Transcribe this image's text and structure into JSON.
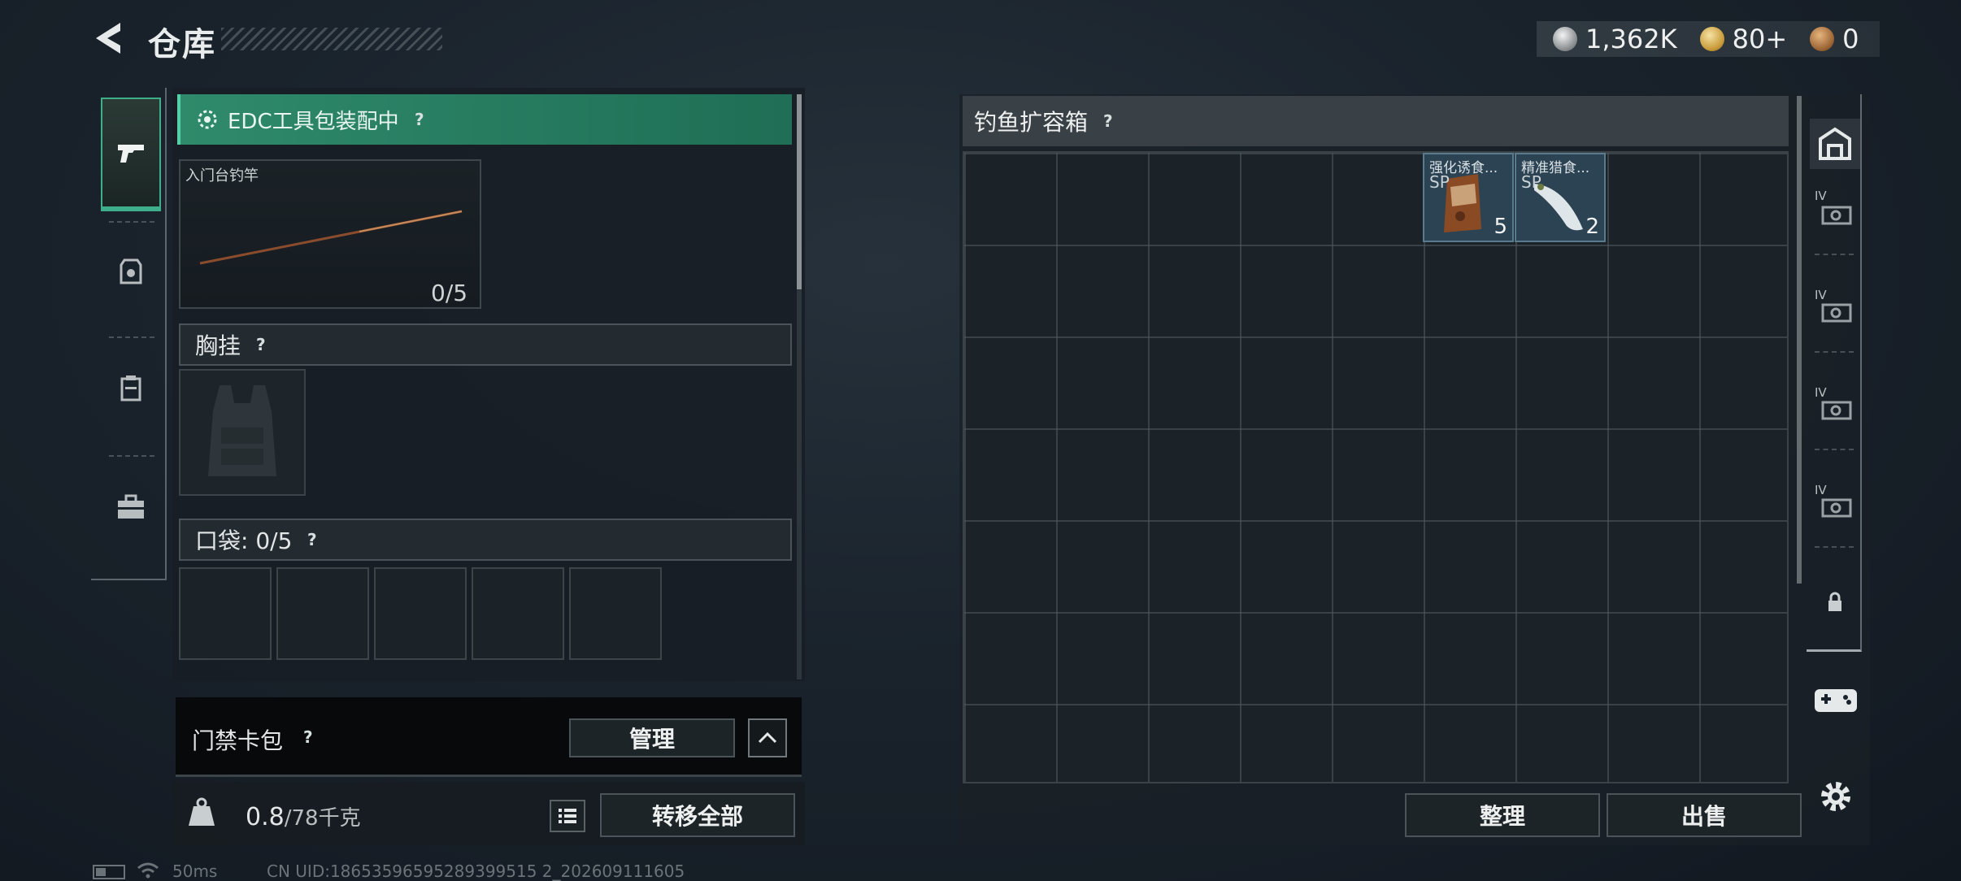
{
  "header": {
    "title": "仓库"
  },
  "currencies": [
    {
      "icon": "silver-coin-icon",
      "value": "1,362K"
    },
    {
      "icon": "gold-coin-icon",
      "value": "80+"
    },
    {
      "icon": "bronze-coin-icon",
      "value": "0"
    }
  ],
  "left_panel": {
    "edc_status": "EDC工具包装配中",
    "rod": {
      "name": "入门台钓竿",
      "count": "0/5"
    },
    "chest_rig_label": "胸挂",
    "pocket_label": "口袋: 0/5",
    "keycard_label": "门禁卡包",
    "manage_label": "管理",
    "weight": "0.8",
    "weight_max": "/78千克",
    "transfer_label": "转移全部"
  },
  "right_panel": {
    "box_title": "钓鱼扩容箱",
    "items": [
      {
        "name": "强化诱食...",
        "tier": "SP",
        "count": "5"
      },
      {
        "name": "精准猎食...",
        "tier": "SP",
        "count": "2"
      }
    ],
    "sort_label": "整理",
    "sell_label": "出售"
  },
  "rail": {
    "tier_labels": [
      "IV",
      "IV",
      "IV",
      "IV"
    ]
  },
  "status": {
    "ping": "50ms",
    "uid": "CN UID:18653596595289399515 2_202609111605"
  },
  "colors": {
    "accent_green": "#2f8a6b",
    "item_blue": "#2c4353"
  }
}
